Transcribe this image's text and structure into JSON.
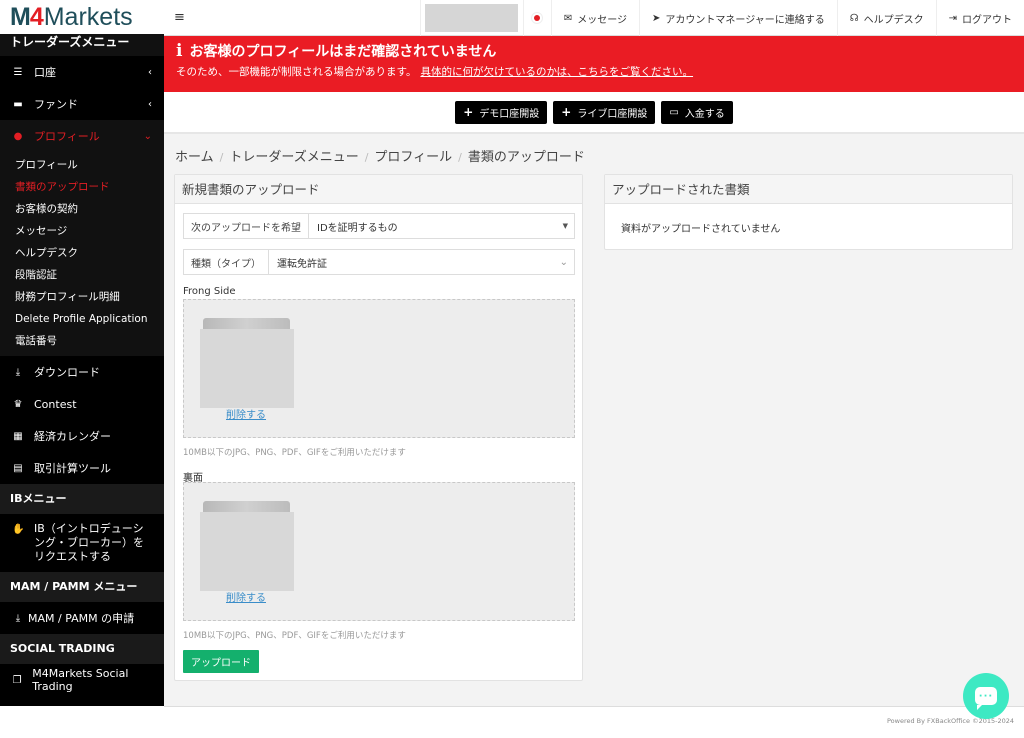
{
  "brand": {
    "logo_m": "M",
    "logo_4": "4",
    "logo_markets": "Markets"
  },
  "topbar": {
    "menu_icon": "hamburger-icon",
    "links": [
      {
        "icon": "envelope-icon",
        "label": "メッセージ"
      },
      {
        "icon": "paper-plane-icon",
        "label": "アカウントマネージャーに連絡する"
      },
      {
        "icon": "headset-icon",
        "label": "ヘルプデスク"
      },
      {
        "icon": "sign-out-icon",
        "label": "ログアウト"
      }
    ]
  },
  "alert": {
    "title": "お客様のプロフィールはまだ確認されていません",
    "body": "そのため、一部機能が制限される場合があります。",
    "link": "具体的に何が欠けているのかは、こちらをご覧ください。"
  },
  "actions": [
    {
      "icon": "plus-icon",
      "label": "デモ口座開設"
    },
    {
      "icon": "plus-icon",
      "label": "ライブ口座開設"
    },
    {
      "icon": "credit-card-icon",
      "label": "入金する"
    }
  ],
  "sidebar": {
    "traders_header": "トレーダーズメニュー",
    "items": [
      {
        "icon": "list-icon",
        "label": "口座",
        "chevron": "‹"
      },
      {
        "icon": "wallet-icon",
        "label": "ファンド",
        "chevron": "‹"
      },
      {
        "icon": "user-icon",
        "label": "プロフィール",
        "chevron": "⌄"
      }
    ],
    "profile_sub": [
      "プロフィール",
      "書類のアップロード",
      "お客様の契約",
      "メッセージ",
      "ヘルプデスク",
      "段階認証",
      "財務プロフィール明細",
      "Delete Profile Application",
      "電話番号"
    ],
    "items2": [
      {
        "icon": "download-icon",
        "label": "ダウンロード"
      },
      {
        "icon": "trophy-icon",
        "label": "Contest"
      },
      {
        "icon": "calendar-icon",
        "label": "経済カレンダー"
      },
      {
        "icon": "calculator-icon",
        "label": "取引計算ツール"
      }
    ],
    "ib_header": "IBメニュー",
    "ib_item": "IB（イントロデューシング・ブローカー）をリクエストする",
    "mam_header": "MAM / PAMM メニュー",
    "mam_item": "MAM / PAMM の申請",
    "social_header": "SOCIAL TRADING",
    "social_item": "M4Markets Social Trading"
  },
  "breadcrumb": [
    "ホーム",
    "トレーダーズメニュー",
    "プロフィール",
    "書類のアップロード"
  ],
  "upload_panel": {
    "title": "新規書類のアップロード",
    "doc_label": "次のアップロードを希望",
    "doc_value": "IDを証明するもの",
    "type_label": "種類（タイプ）",
    "type_value": "運転免許証",
    "front_label": "Frong Side",
    "back_label": "裏面",
    "delete_label": "削除する",
    "hint": "10MB以下のJPG、PNG、PDF、GIFをご利用いただけます",
    "upload_button": "アップロード"
  },
  "uploaded_panel": {
    "title": "アップロードされた書類",
    "empty": "資料がアップロードされていません"
  },
  "footer": {
    "text": "Powered By FXBackOffice ©2015-2024"
  },
  "colors": {
    "brand_red": "#ea1c24",
    "upload_green": "#14b06d",
    "chat_teal": "#3de9c3",
    "link_blue": "#3a8dc9"
  }
}
